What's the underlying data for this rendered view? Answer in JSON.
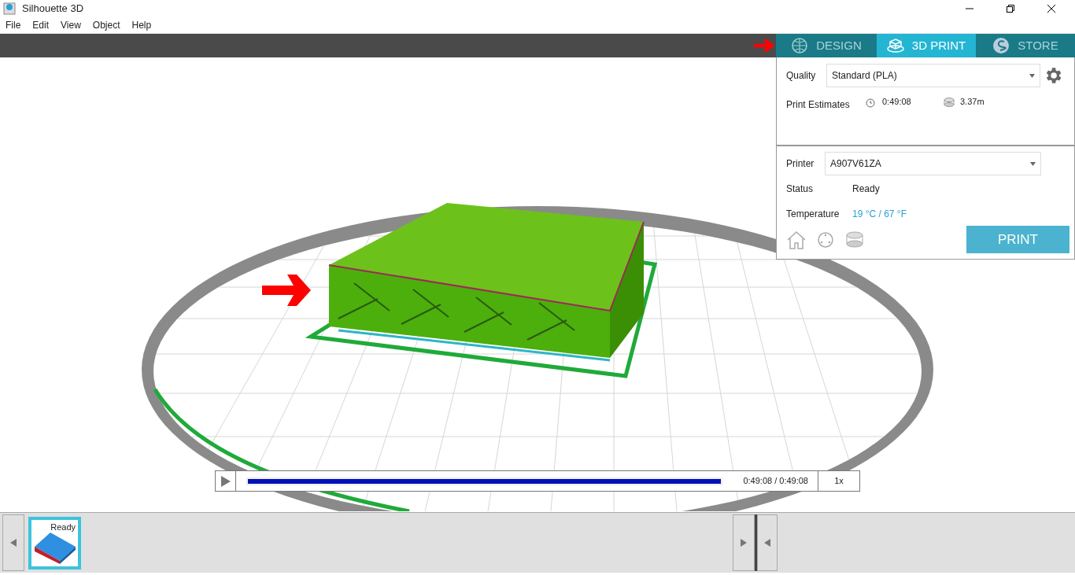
{
  "window": {
    "title": "Silhouette 3D"
  },
  "menu": [
    "File",
    "Edit",
    "View",
    "Object",
    "Help"
  ],
  "tabs": [
    {
      "label": "DESIGN",
      "selected": false
    },
    {
      "label": "3D PRINT",
      "selected": true
    },
    {
      "label": "STORE",
      "selected": false
    }
  ],
  "quality": {
    "label": "Quality",
    "value": "Standard (PLA)"
  },
  "estimates": {
    "label": "Print Estimates",
    "time": "0:49:08",
    "filament": "3.37m"
  },
  "printer": {
    "label": "Printer",
    "value": "A907V61ZA"
  },
  "status": {
    "label": "Status",
    "value": "Ready"
  },
  "temperature": {
    "label": "Temperature",
    "value": "19 °C / 67 °F"
  },
  "print_button": "PRINT",
  "playback": {
    "level": 1,
    "time": "0:49:08 / 0:49:08",
    "speed": "1x"
  },
  "jobs": [
    {
      "status": "Ready",
      "selected": true
    }
  ]
}
